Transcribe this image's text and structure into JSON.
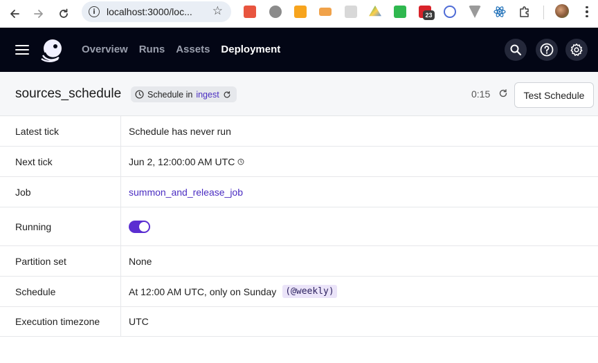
{
  "browser": {
    "url": "localhost:3000/loc...",
    "badge_count": "23",
    "colors": {
      "omnibox_bg": "#e9eef5"
    }
  },
  "app": {
    "nav": {
      "overview": "Overview",
      "runs": "Runs",
      "assets": "Assets",
      "deployment": "Deployment"
    },
    "colors": {
      "header_bg": "#030615",
      "accent": "#4b2ec2",
      "toggle": "#5b2ed1"
    }
  },
  "page": {
    "title": "sources_schedule",
    "tag_prefix": "Schedule in",
    "tag_link": "ingest",
    "timer": "0:15",
    "test_button": "Test Schedule"
  },
  "details": [
    {
      "label": "Latest tick",
      "value": "Schedule has never run"
    },
    {
      "label": "Next tick",
      "value": "Jun 2, 12:00:00 AM UTC"
    },
    {
      "label": "Job",
      "value": "summon_and_release_job"
    },
    {
      "label": "Running",
      "value": true
    },
    {
      "label": "Partition set",
      "value": "None"
    },
    {
      "label": "Schedule",
      "value": "At 12:00 AM UTC, only on Sunday",
      "cron": "(@weekly)"
    },
    {
      "label": "Execution timezone",
      "value": "UTC"
    }
  ]
}
